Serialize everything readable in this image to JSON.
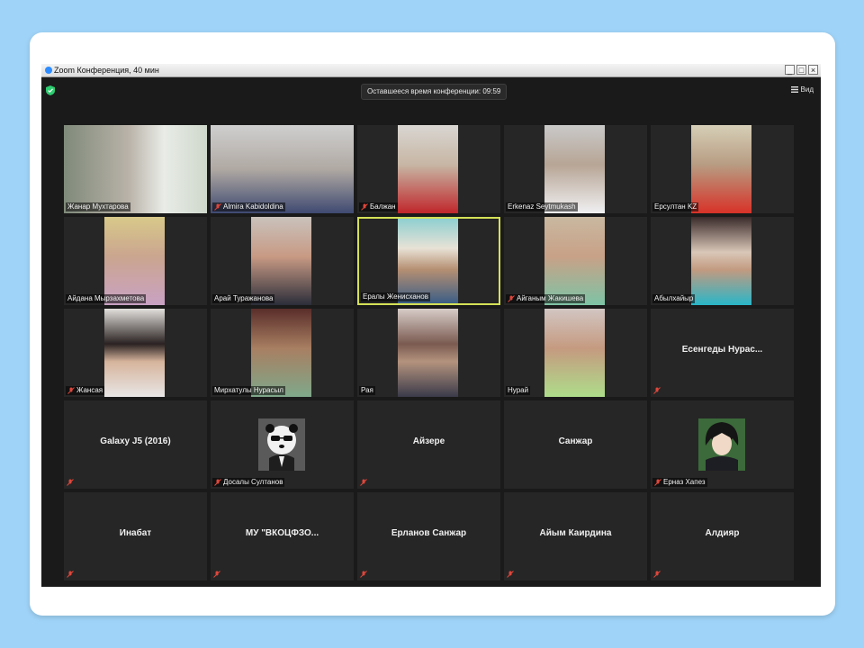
{
  "window": {
    "title": "Zoom Конференция, 40 мин"
  },
  "header": {
    "timer_label": "Оставшееся время конференции: 09:59",
    "view_label": "Вид"
  },
  "participants": [
    {
      "name": "Жанар Мухтарова",
      "muted": false
    },
    {
      "name": "Almira Kabidoldina",
      "muted": true
    },
    {
      "name": "Балжан",
      "muted": true
    },
    {
      "name": "Erkenaz Seytmukash",
      "muted": false
    },
    {
      "name": "Ерсултан KZ",
      "muted": false
    },
    {
      "name": "Айдана Мырзахметова",
      "muted": false
    },
    {
      "name": "Арай Туражанова",
      "muted": false
    },
    {
      "name": "Ералы Женисханов",
      "muted": false
    },
    {
      "name": "Айганым Жакишева",
      "muted": true
    },
    {
      "name": "Абылхайыр",
      "muted": false
    },
    {
      "name": "Жансая",
      "muted": true
    },
    {
      "name": "Мирхатулы Нурасыл",
      "muted": false
    },
    {
      "name": "Рая",
      "muted": false
    },
    {
      "name": "Нурай",
      "muted": false
    },
    {
      "name": "Есенгеды Нурас...",
      "muted": true
    },
    {
      "name": "Galaxy J5 (2016)",
      "muted": true
    },
    {
      "name": "Досалы Султанов",
      "muted": true
    },
    {
      "name": "Айзере",
      "muted": true
    },
    {
      "name": "Санжар",
      "muted": false
    },
    {
      "name": "Ерназ Хапез",
      "muted": true
    },
    {
      "name": "Инабат",
      "muted": true
    },
    {
      "name": "МУ \"ВКОЦФЗО...",
      "muted": true
    },
    {
      "name": "Ерланов Санжар",
      "muted": true
    },
    {
      "name": "Айым Каирдина",
      "muted": true
    },
    {
      "name": "Алдияр",
      "muted": true
    }
  ],
  "colors": {
    "active_speaker": "#d4e157",
    "tile_bg": "#262626",
    "mute_icon": "#e0463a"
  }
}
